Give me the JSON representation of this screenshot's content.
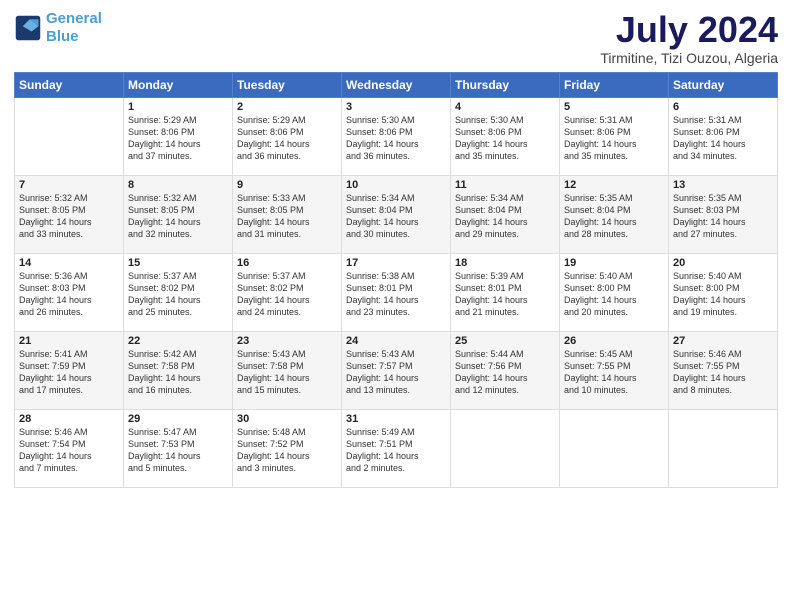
{
  "logo": {
    "line1": "General",
    "line2": "Blue"
  },
  "title": "July 2024",
  "subtitle": "Tirmitine, Tizi Ouzou, Algeria",
  "days_of_week": [
    "Sunday",
    "Monday",
    "Tuesday",
    "Wednesday",
    "Thursday",
    "Friday",
    "Saturday"
  ],
  "weeks": [
    [
      {
        "day": "",
        "info": ""
      },
      {
        "day": "1",
        "info": "Sunrise: 5:29 AM\nSunset: 8:06 PM\nDaylight: 14 hours\nand 37 minutes."
      },
      {
        "day": "2",
        "info": "Sunrise: 5:29 AM\nSunset: 8:06 PM\nDaylight: 14 hours\nand 36 minutes."
      },
      {
        "day": "3",
        "info": "Sunrise: 5:30 AM\nSunset: 8:06 PM\nDaylight: 14 hours\nand 36 minutes."
      },
      {
        "day": "4",
        "info": "Sunrise: 5:30 AM\nSunset: 8:06 PM\nDaylight: 14 hours\nand 35 minutes."
      },
      {
        "day": "5",
        "info": "Sunrise: 5:31 AM\nSunset: 8:06 PM\nDaylight: 14 hours\nand 35 minutes."
      },
      {
        "day": "6",
        "info": "Sunrise: 5:31 AM\nSunset: 8:06 PM\nDaylight: 14 hours\nand 34 minutes."
      }
    ],
    [
      {
        "day": "7",
        "info": "Sunrise: 5:32 AM\nSunset: 8:05 PM\nDaylight: 14 hours\nand 33 minutes."
      },
      {
        "day": "8",
        "info": "Sunrise: 5:32 AM\nSunset: 8:05 PM\nDaylight: 14 hours\nand 32 minutes."
      },
      {
        "day": "9",
        "info": "Sunrise: 5:33 AM\nSunset: 8:05 PM\nDaylight: 14 hours\nand 31 minutes."
      },
      {
        "day": "10",
        "info": "Sunrise: 5:34 AM\nSunset: 8:04 PM\nDaylight: 14 hours\nand 30 minutes."
      },
      {
        "day": "11",
        "info": "Sunrise: 5:34 AM\nSunset: 8:04 PM\nDaylight: 14 hours\nand 29 minutes."
      },
      {
        "day": "12",
        "info": "Sunrise: 5:35 AM\nSunset: 8:04 PM\nDaylight: 14 hours\nand 28 minutes."
      },
      {
        "day": "13",
        "info": "Sunrise: 5:35 AM\nSunset: 8:03 PM\nDaylight: 14 hours\nand 27 minutes."
      }
    ],
    [
      {
        "day": "14",
        "info": "Sunrise: 5:36 AM\nSunset: 8:03 PM\nDaylight: 14 hours\nand 26 minutes."
      },
      {
        "day": "15",
        "info": "Sunrise: 5:37 AM\nSunset: 8:02 PM\nDaylight: 14 hours\nand 25 minutes."
      },
      {
        "day": "16",
        "info": "Sunrise: 5:37 AM\nSunset: 8:02 PM\nDaylight: 14 hours\nand 24 minutes."
      },
      {
        "day": "17",
        "info": "Sunrise: 5:38 AM\nSunset: 8:01 PM\nDaylight: 14 hours\nand 23 minutes."
      },
      {
        "day": "18",
        "info": "Sunrise: 5:39 AM\nSunset: 8:01 PM\nDaylight: 14 hours\nand 21 minutes."
      },
      {
        "day": "19",
        "info": "Sunrise: 5:40 AM\nSunset: 8:00 PM\nDaylight: 14 hours\nand 20 minutes."
      },
      {
        "day": "20",
        "info": "Sunrise: 5:40 AM\nSunset: 8:00 PM\nDaylight: 14 hours\nand 19 minutes."
      }
    ],
    [
      {
        "day": "21",
        "info": "Sunrise: 5:41 AM\nSunset: 7:59 PM\nDaylight: 14 hours\nand 17 minutes."
      },
      {
        "day": "22",
        "info": "Sunrise: 5:42 AM\nSunset: 7:58 PM\nDaylight: 14 hours\nand 16 minutes."
      },
      {
        "day": "23",
        "info": "Sunrise: 5:43 AM\nSunset: 7:58 PM\nDaylight: 14 hours\nand 15 minutes."
      },
      {
        "day": "24",
        "info": "Sunrise: 5:43 AM\nSunset: 7:57 PM\nDaylight: 14 hours\nand 13 minutes."
      },
      {
        "day": "25",
        "info": "Sunrise: 5:44 AM\nSunset: 7:56 PM\nDaylight: 14 hours\nand 12 minutes."
      },
      {
        "day": "26",
        "info": "Sunrise: 5:45 AM\nSunset: 7:55 PM\nDaylight: 14 hours\nand 10 minutes."
      },
      {
        "day": "27",
        "info": "Sunrise: 5:46 AM\nSunset: 7:55 PM\nDaylight: 14 hours\nand 8 minutes."
      }
    ],
    [
      {
        "day": "28",
        "info": "Sunrise: 5:46 AM\nSunset: 7:54 PM\nDaylight: 14 hours\nand 7 minutes."
      },
      {
        "day": "29",
        "info": "Sunrise: 5:47 AM\nSunset: 7:53 PM\nDaylight: 14 hours\nand 5 minutes."
      },
      {
        "day": "30",
        "info": "Sunrise: 5:48 AM\nSunset: 7:52 PM\nDaylight: 14 hours\nand 3 minutes."
      },
      {
        "day": "31",
        "info": "Sunrise: 5:49 AM\nSunset: 7:51 PM\nDaylight: 14 hours\nand 2 minutes."
      },
      {
        "day": "",
        "info": ""
      },
      {
        "day": "",
        "info": ""
      },
      {
        "day": "",
        "info": ""
      }
    ]
  ]
}
